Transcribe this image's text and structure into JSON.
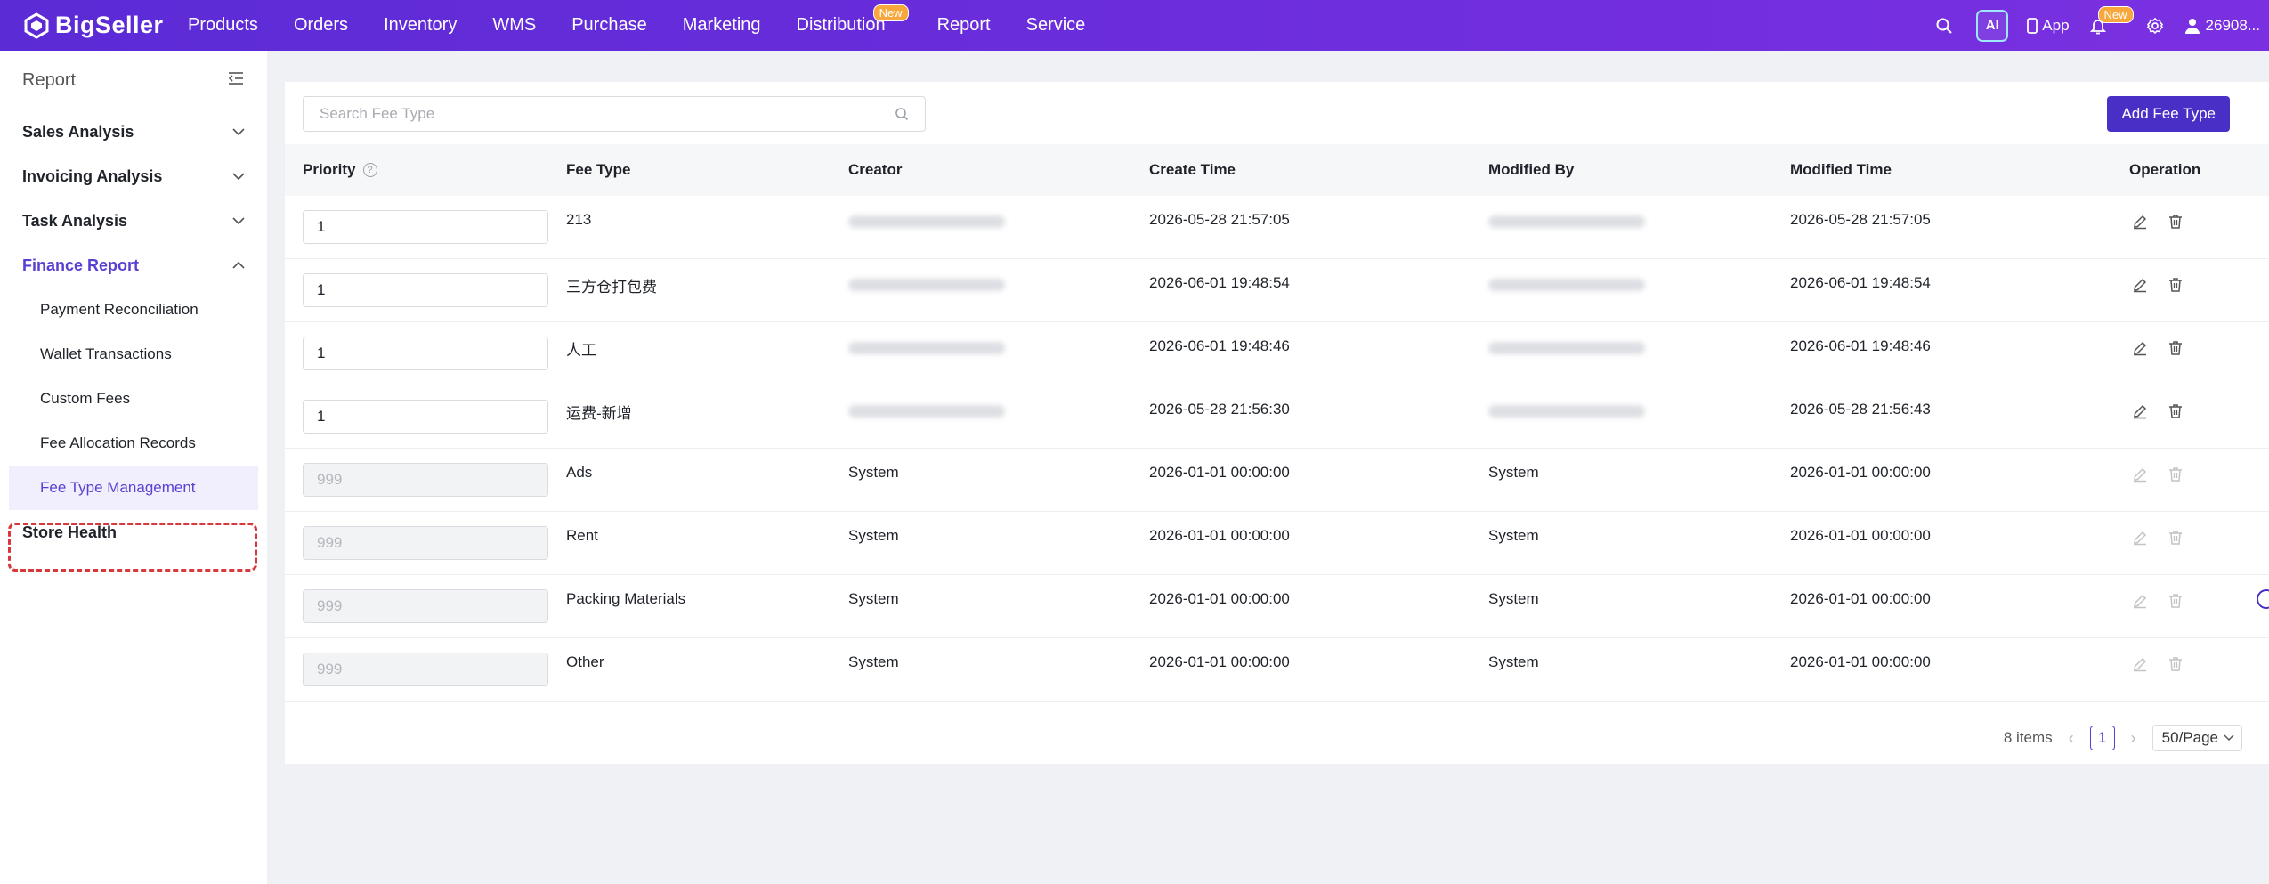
{
  "topbar": {
    "logo": "BigSeller",
    "nav": [
      "Products",
      "Orders",
      "Inventory",
      "WMS",
      "Purchase",
      "Marketing",
      "Distribution",
      "Report",
      "Service"
    ],
    "new_badge": "New",
    "ai": "AI",
    "app": "App",
    "bell_badge": "New",
    "user": "26908..."
  },
  "sidebar": {
    "title": "Report",
    "groups": [
      {
        "label": "Sales Analysis"
      },
      {
        "label": "Invoicing Analysis"
      },
      {
        "label": "Task Analysis"
      },
      {
        "label": "Finance Report"
      }
    ],
    "finance_items": [
      "Payment Reconciliation",
      "Wallet Transactions",
      "Custom Fees",
      "Fee Allocation Records",
      "Fee Type Management"
    ],
    "store_health": "Store Health"
  },
  "toolbar": {
    "search_placeholder": "Search Fee Type",
    "add_label": "Add Fee Type"
  },
  "table": {
    "headers": {
      "priority": "Priority",
      "fee_type": "Fee Type",
      "creator": "Creator",
      "create_time": "Create Time",
      "modified_by": "Modified By",
      "modified_time": "Modified Time",
      "operation": "Operation"
    },
    "rows": [
      {
        "priority": "1",
        "fee_type": "213",
        "creator": "",
        "create_time": "2026-05-28 21:57:05",
        "modified_by": "",
        "modified_time": "2026-05-28 21:57:05"
      },
      {
        "priority": "1",
        "fee_type": "三方仓打包费",
        "creator": "",
        "create_time": "2026-06-01 19:48:54",
        "modified_by": "",
        "modified_time": "2026-06-01 19:48:54"
      },
      {
        "priority": "1",
        "fee_type": "人工",
        "creator": "",
        "create_time": "2026-06-01 19:48:46",
        "modified_by": "",
        "modified_time": "2026-06-01 19:48:46"
      },
      {
        "priority": "1",
        "fee_type": "运费-新增",
        "creator": "",
        "create_time": "2026-05-28 21:56:30",
        "modified_by": "",
        "modified_time": "2026-05-28 21:56:43"
      },
      {
        "priority": "999",
        "fee_type": "Ads",
        "creator": "System",
        "create_time": "2026-01-01 00:00:00",
        "modified_by": "System",
        "modified_time": "2026-01-01 00:00:00"
      },
      {
        "priority": "999",
        "fee_type": "Rent",
        "creator": "System",
        "create_time": "2026-01-01 00:00:00",
        "modified_by": "System",
        "modified_time": "2026-01-01 00:00:00"
      },
      {
        "priority": "999",
        "fee_type": "Packing Materials",
        "creator": "System",
        "create_time": "2026-01-01 00:00:00",
        "modified_by": "System",
        "modified_time": "2026-01-01 00:00:00"
      },
      {
        "priority": "999",
        "fee_type": "Other",
        "creator": "System",
        "create_time": "2026-01-01 00:00:00",
        "modified_by": "System",
        "modified_time": "2026-01-01 00:00:00"
      }
    ]
  },
  "pagination": {
    "total": "8 items",
    "page": "1",
    "page_size": "50/Page"
  }
}
